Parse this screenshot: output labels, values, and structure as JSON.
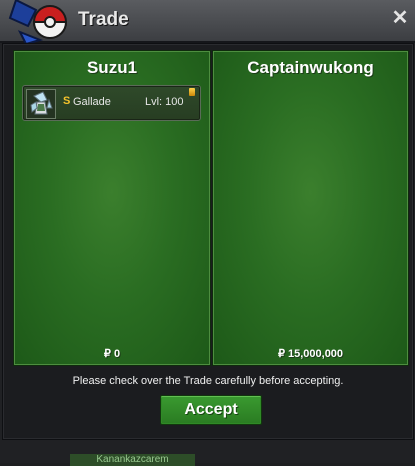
{
  "window": {
    "title": "Trade",
    "close_label": "✕"
  },
  "trade": {
    "left": {
      "player_name": "Suzu1",
      "items": [
        {
          "shiny_marker": "S",
          "pokemon": "Gallade",
          "level": "Lvl: 100"
        }
      ],
      "money": "₽ 0"
    },
    "right": {
      "player_name": "Captainwukong",
      "money": "₽ 15,000,000"
    }
  },
  "footer": {
    "notice": "Please check over the Trade carefully before accepting.",
    "accept_label": "Accept"
  },
  "background": {
    "partial_text": "Kanankazcarem"
  },
  "colors": {
    "panel_green": "#2a6d22",
    "accept_green": "#2f8a26",
    "shiny_gold": "#f4c22c"
  }
}
